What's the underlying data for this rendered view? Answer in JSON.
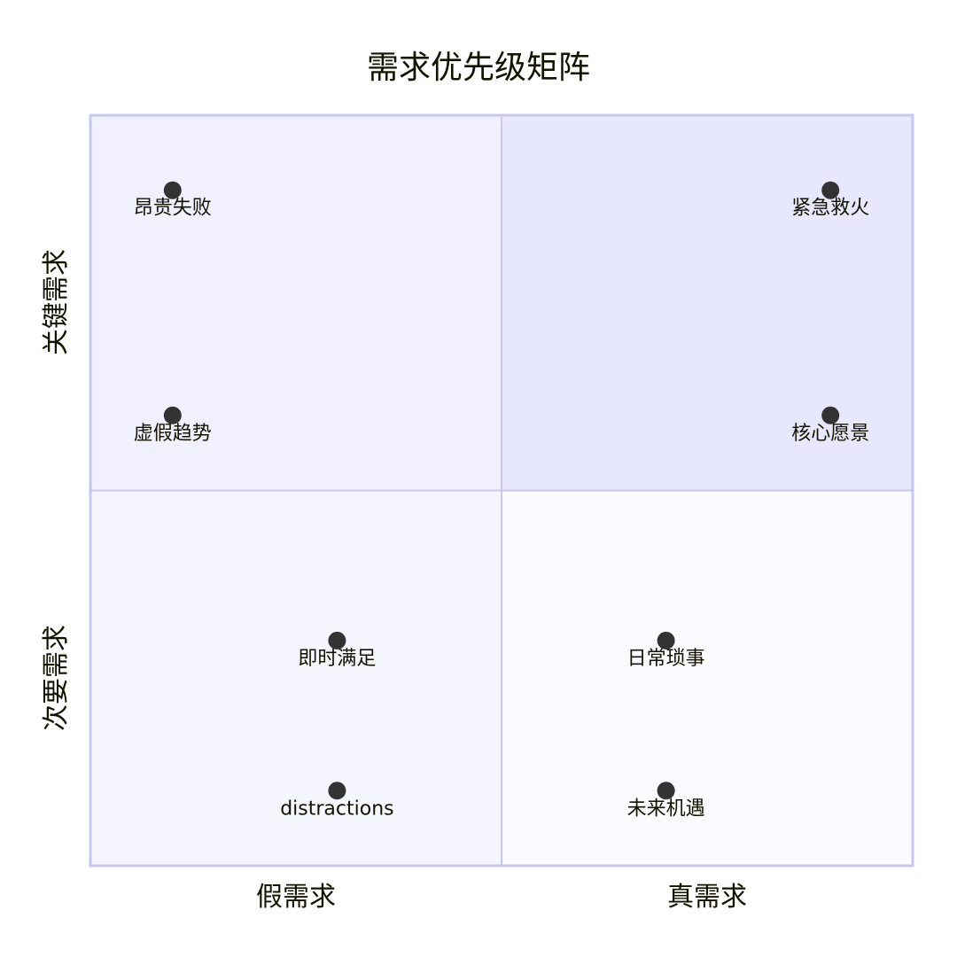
{
  "chart_data": {
    "type": "scatter",
    "subtype": "quadrant",
    "title": "需求优先级矩阵",
    "x_axis": {
      "left": "假需求",
      "right": "真需求"
    },
    "y_axis": {
      "bottom": "次要需求",
      "top": "关键需求"
    },
    "xlim": [
      0,
      1
    ],
    "ylim": [
      0,
      1
    ],
    "points": [
      {
        "label": "昂贵失败",
        "x": 0.1,
        "y": 0.9
      },
      {
        "label": "紧急救火",
        "x": 0.9,
        "y": 0.9
      },
      {
        "label": "虚假趋势",
        "x": 0.1,
        "y": 0.6
      },
      {
        "label": "核心愿景",
        "x": 0.9,
        "y": 0.6
      },
      {
        "label": "即时满足",
        "x": 0.3,
        "y": 0.3
      },
      {
        "label": "distractions",
        "x": 0.3,
        "y": 0.1
      },
      {
        "label": "日常琐事",
        "x": 0.7,
        "y": 0.3
      },
      {
        "label": "未来机遇",
        "x": 0.7,
        "y": 0.1
      }
    ],
    "colors": {
      "quadrant_top_right": "#e8e8fc",
      "quadrant_top_left": "#f0f0fe",
      "quadrant_bottom_left": "#f5f5fe",
      "quadrant_bottom_right": "#fafaff",
      "border": "#c7c7f1",
      "point": "#333333",
      "text": "#131300"
    }
  }
}
